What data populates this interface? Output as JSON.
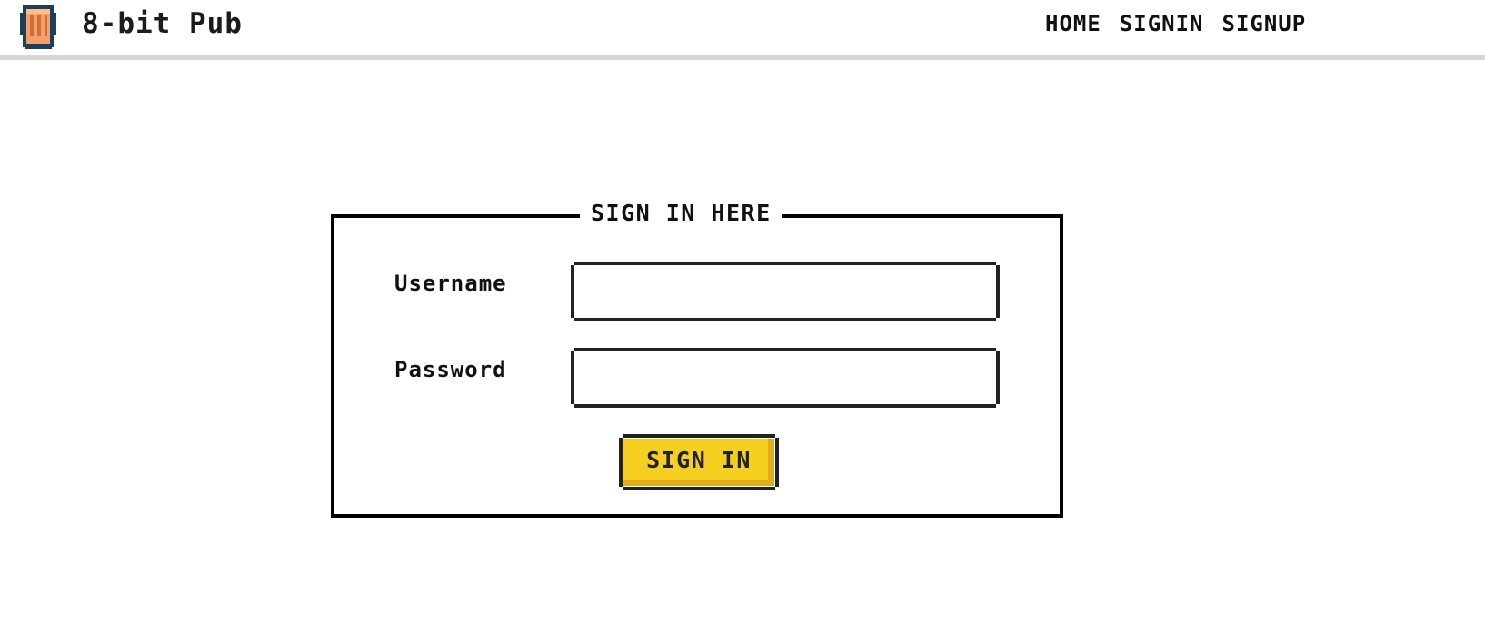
{
  "header": {
    "logo": {
      "icon": "pixel-beer-mug-icon",
      "colors": {
        "outline": "#1b3f5f",
        "drink": "#f3a06b",
        "shade": "#cc6f3b"
      }
    },
    "brand_name": "8-bit Pub",
    "nav": {
      "home_label": "HOME",
      "signin_label": "SIGNIN",
      "signup_label": "SIGNUP"
    }
  },
  "signin": {
    "title": "SIGN IN HERE",
    "username": {
      "label": "Username",
      "value": "",
      "placeholder": ""
    },
    "password": {
      "label": "Password",
      "value": "",
      "placeholder": ""
    },
    "submit_label": "SIGN IN"
  },
  "theme": {
    "accent_button": "#f5cf1f",
    "button_shadow": "#e1ad18",
    "border": "#000000",
    "header_divider": "#d6d6d6",
    "text": "#111111"
  }
}
